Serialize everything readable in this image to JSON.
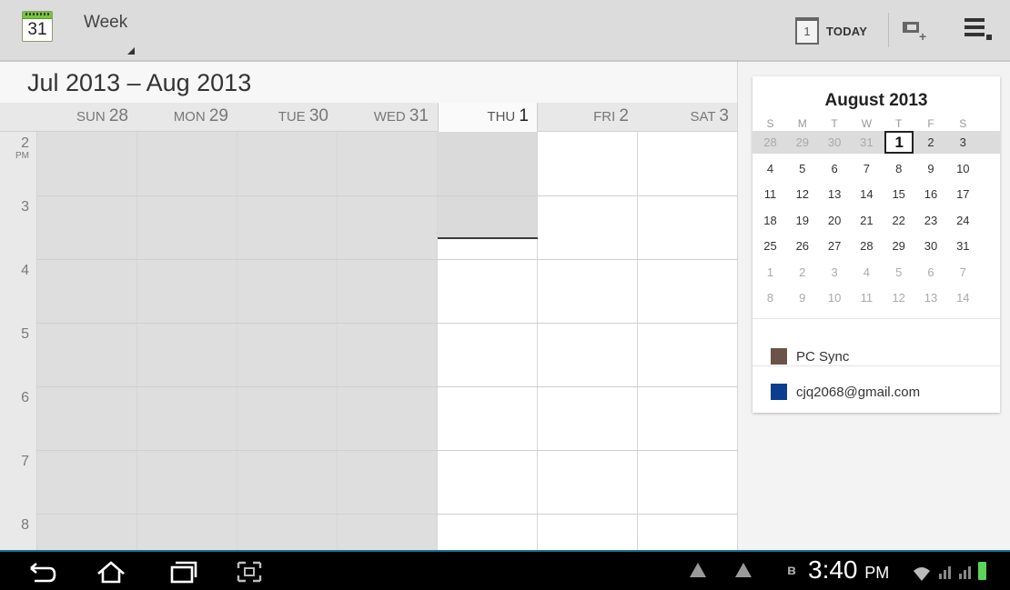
{
  "topbar": {
    "app_icon_number": "31",
    "view_mode": "Week",
    "today_icon_number": "1",
    "today_label": "TODAY"
  },
  "week": {
    "range_title": "Jul 2013 – Aug 2013",
    "days": [
      {
        "abbr": "SUN",
        "num": "28"
      },
      {
        "abbr": "MON",
        "num": "29"
      },
      {
        "abbr": "TUE",
        "num": "30"
      },
      {
        "abbr": "WED",
        "num": "31"
      },
      {
        "abbr": "THU",
        "num": "1"
      },
      {
        "abbr": "FRI",
        "num": "2"
      },
      {
        "abbr": "SAT",
        "num": "3"
      }
    ],
    "hours": [
      {
        "h": "2",
        "ampm": "PM"
      },
      {
        "h": "3",
        "ampm": ""
      },
      {
        "h": "4",
        "ampm": ""
      },
      {
        "h": "5",
        "ampm": ""
      },
      {
        "h": "6",
        "ampm": ""
      },
      {
        "h": "7",
        "ampm": ""
      },
      {
        "h": "8",
        "ampm": ""
      }
    ]
  },
  "mini_calendar": {
    "title": "August 2013",
    "dow": [
      "S",
      "M",
      "T",
      "W",
      "T",
      "F",
      "S"
    ],
    "rows": [
      [
        "28",
        "29",
        "30",
        "31",
        "1",
        "2",
        "3"
      ],
      [
        "4",
        "5",
        "6",
        "7",
        "8",
        "9",
        "10"
      ],
      [
        "11",
        "12",
        "13",
        "14",
        "15",
        "16",
        "17"
      ],
      [
        "18",
        "19",
        "20",
        "21",
        "22",
        "23",
        "24"
      ],
      [
        "25",
        "26",
        "27",
        "28",
        "29",
        "30",
        "31"
      ],
      [
        "1",
        "2",
        "3",
        "4",
        "5",
        "6",
        "7"
      ],
      [
        "8",
        "9",
        "10",
        "11",
        "12",
        "13",
        "14"
      ]
    ]
  },
  "calendars": [
    {
      "name": "PC Sync",
      "color": "#6b5447"
    },
    {
      "name": "cjq2068@gmail.com",
      "color": "#0b3d91"
    }
  ],
  "statusbar": {
    "time": "3:40",
    "ampm": "PM"
  }
}
